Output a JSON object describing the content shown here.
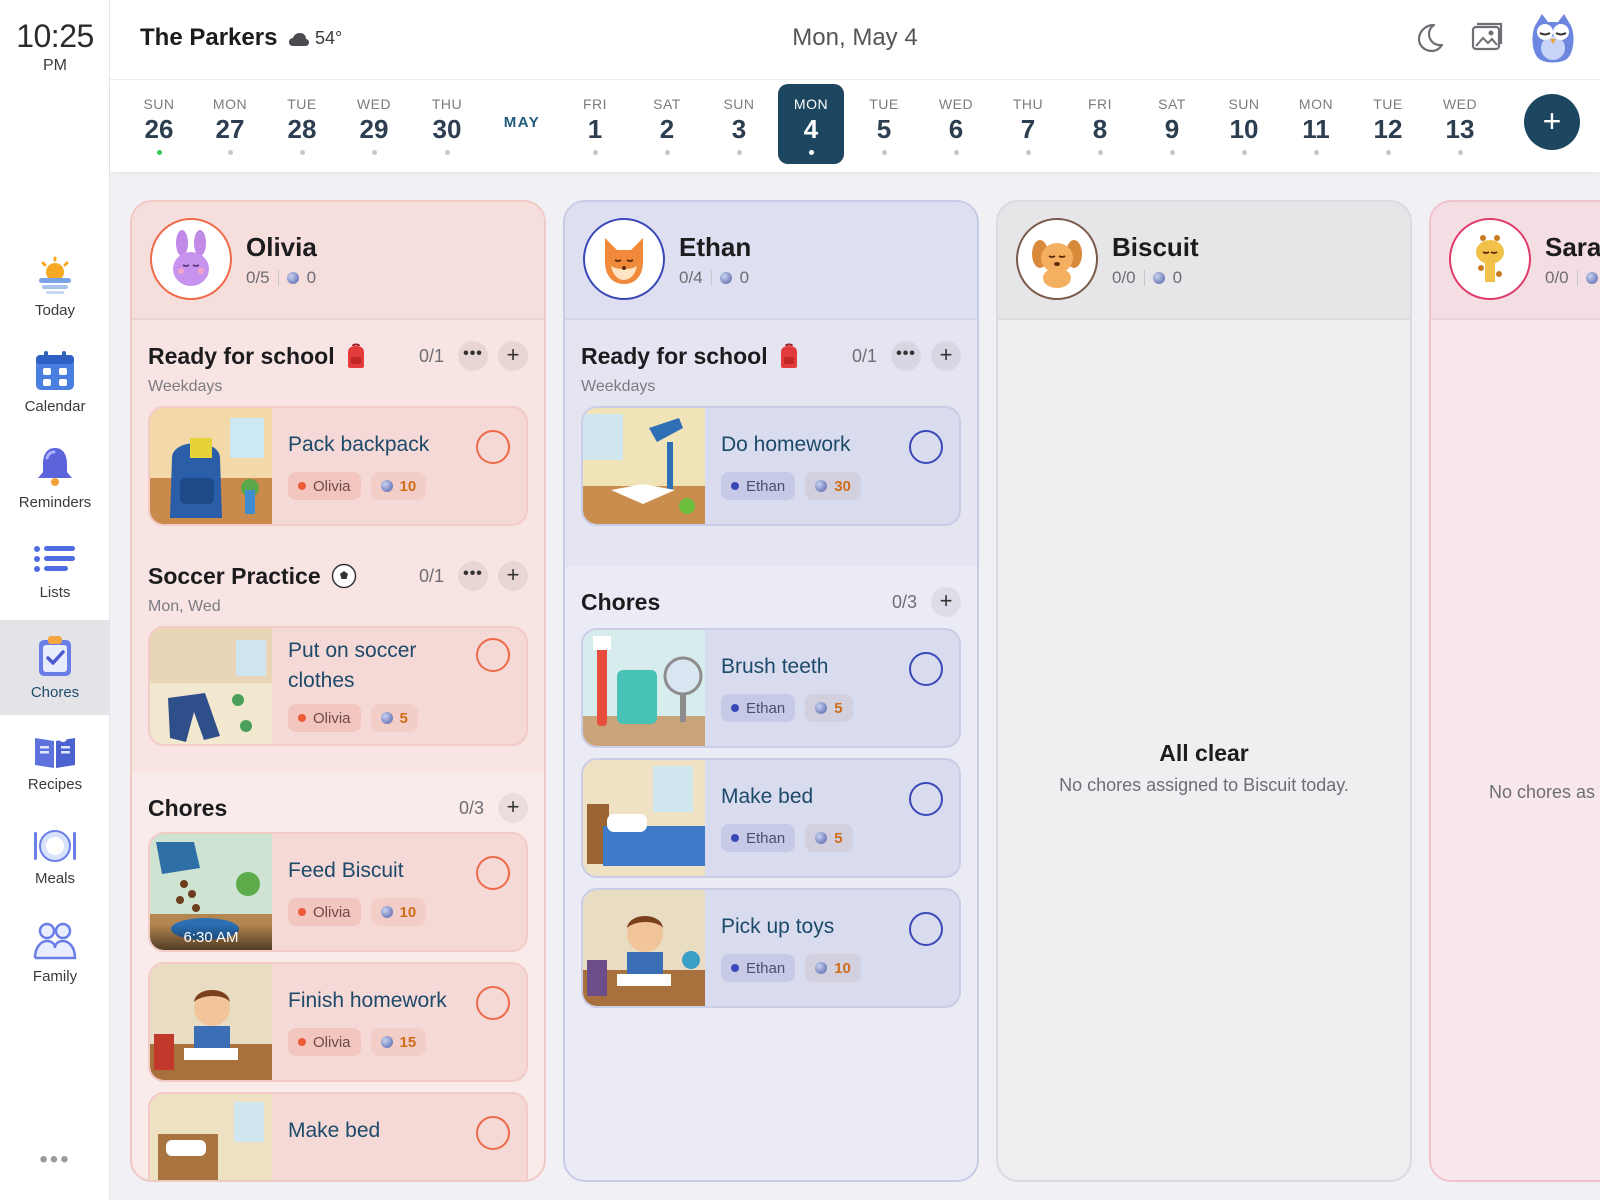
{
  "clock": {
    "time": "10:25",
    "ampm": "PM"
  },
  "header": {
    "family": "The Parkers",
    "temp": "54°",
    "date": "Mon, May 4"
  },
  "nav": [
    {
      "key": "today",
      "label": "Today"
    },
    {
      "key": "calendar",
      "label": "Calendar"
    },
    {
      "key": "reminders",
      "label": "Reminders"
    },
    {
      "key": "lists",
      "label": "Lists"
    },
    {
      "key": "chores",
      "label": "Chores",
      "active": true
    },
    {
      "key": "recipes",
      "label": "Recipes"
    },
    {
      "key": "meals",
      "label": "Meals"
    },
    {
      "key": "family",
      "label": "Family"
    }
  ],
  "week": {
    "month_label": "MAY",
    "days": [
      {
        "dow": "SUN",
        "num": "26",
        "dot": "green"
      },
      {
        "dow": "MON",
        "num": "27"
      },
      {
        "dow": "TUE",
        "num": "28"
      },
      {
        "dow": "WED",
        "num": "29"
      },
      {
        "dow": "THU",
        "num": "30"
      },
      {
        "dow": "FRI",
        "num": "1"
      },
      {
        "dow": "SAT",
        "num": "2"
      },
      {
        "dow": "SUN",
        "num": "3"
      },
      {
        "dow": "MON",
        "num": "4",
        "selected": true
      },
      {
        "dow": "TUE",
        "num": "5"
      },
      {
        "dow": "WED",
        "num": "6"
      },
      {
        "dow": "THU",
        "num": "7"
      },
      {
        "dow": "FRI",
        "num": "8"
      },
      {
        "dow": "SAT",
        "num": "9"
      },
      {
        "dow": "SUN",
        "num": "10"
      },
      {
        "dow": "MON",
        "num": "11"
      },
      {
        "dow": "TUE",
        "num": "12"
      },
      {
        "dow": "WED",
        "num": "13"
      }
    ]
  },
  "olivia": {
    "name": "Olivia",
    "progress": "0/5",
    "points": "0",
    "sections": [
      {
        "title": "Ready for school",
        "count": "0/1",
        "sub": "Weekdays",
        "cards": [
          {
            "title": "Pack backpack",
            "person": "Olivia",
            "points": "10"
          }
        ]
      },
      {
        "title": "Soccer Practice",
        "count": "0/1",
        "sub": "Mon, Wed",
        "cards": [
          {
            "title": "Put on soccer clothes",
            "person": "Olivia",
            "points": "5"
          }
        ]
      },
      {
        "title": "Chores",
        "count": "0/3",
        "cards": [
          {
            "title": "Feed Biscuit",
            "person": "Olivia",
            "points": "10",
            "time": "6:30 AM"
          },
          {
            "title": "Finish homework",
            "person": "Olivia",
            "points": "15"
          },
          {
            "title": "Make bed"
          }
        ]
      }
    ]
  },
  "ethan": {
    "name": "Ethan",
    "progress": "0/4",
    "points": "0",
    "sections": [
      {
        "title": "Ready for school",
        "count": "0/1",
        "sub": "Weekdays",
        "cards": [
          {
            "title": "Do homework",
            "person": "Ethan",
            "points": "30"
          }
        ]
      },
      {
        "title": "Chores",
        "count": "0/3",
        "cards": [
          {
            "title": "Brush teeth",
            "person": "Ethan",
            "points": "5"
          },
          {
            "title": "Make bed",
            "person": "Ethan",
            "points": "5"
          },
          {
            "title": "Pick up toys",
            "person": "Ethan",
            "points": "10"
          }
        ]
      }
    ]
  },
  "biscuit": {
    "name": "Biscuit",
    "progress": "0/0",
    "points": "0",
    "empty_title": "All clear",
    "empty_sub": "No chores assigned to Biscuit today."
  },
  "sara": {
    "name": "Sara",
    "progress": "0/0",
    "empty_sub": "No chores as"
  },
  "colors": {
    "primary": "#1d4760",
    "olivia": "#ee6a48",
    "ethan": "#3b49b8",
    "biscuit": "#7a5a4a",
    "sara": "#e03a6a",
    "points": "#d06d19"
  }
}
